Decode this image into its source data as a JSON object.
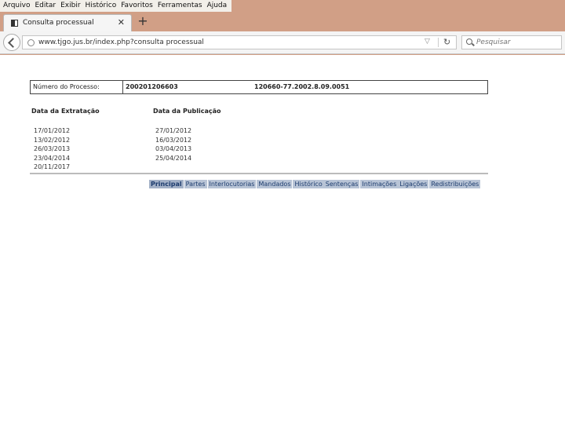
{
  "browser": {
    "menu": [
      "Arquivo",
      "Editar",
      "Exibir",
      "Histórico",
      "Favoritos",
      "Ferramentas",
      "Ajuda"
    ],
    "tab_title": "Consulta processual",
    "close_glyph": "✕",
    "new_tab_glyph": "+",
    "url": "www.tjgo.jus.br/index.php?consulta processual",
    "search_placeholder": "Pesquisar"
  },
  "process": {
    "label": "Número do Processo:",
    "number": "200201206603",
    "alt_number": "120660-77.2002.8.09.0051"
  },
  "headers": {
    "extraction": "Data da Extratação",
    "publication": "Data da Publicação"
  },
  "extraction_dates": [
    "17/01/2012",
    "13/02/2012",
    "26/03/2013",
    "23/04/2014",
    "20/11/2017"
  ],
  "publication_dates": [
    "27/01/2012",
    "16/03/2012",
    "03/04/2013",
    "25/04/2014"
  ],
  "tabs": [
    "Principal",
    "Partes",
    "Interlocutorias",
    "Mandados",
    "Histórico",
    "Sentenças",
    "Intimações",
    "Ligações",
    "Redistribuições"
  ]
}
